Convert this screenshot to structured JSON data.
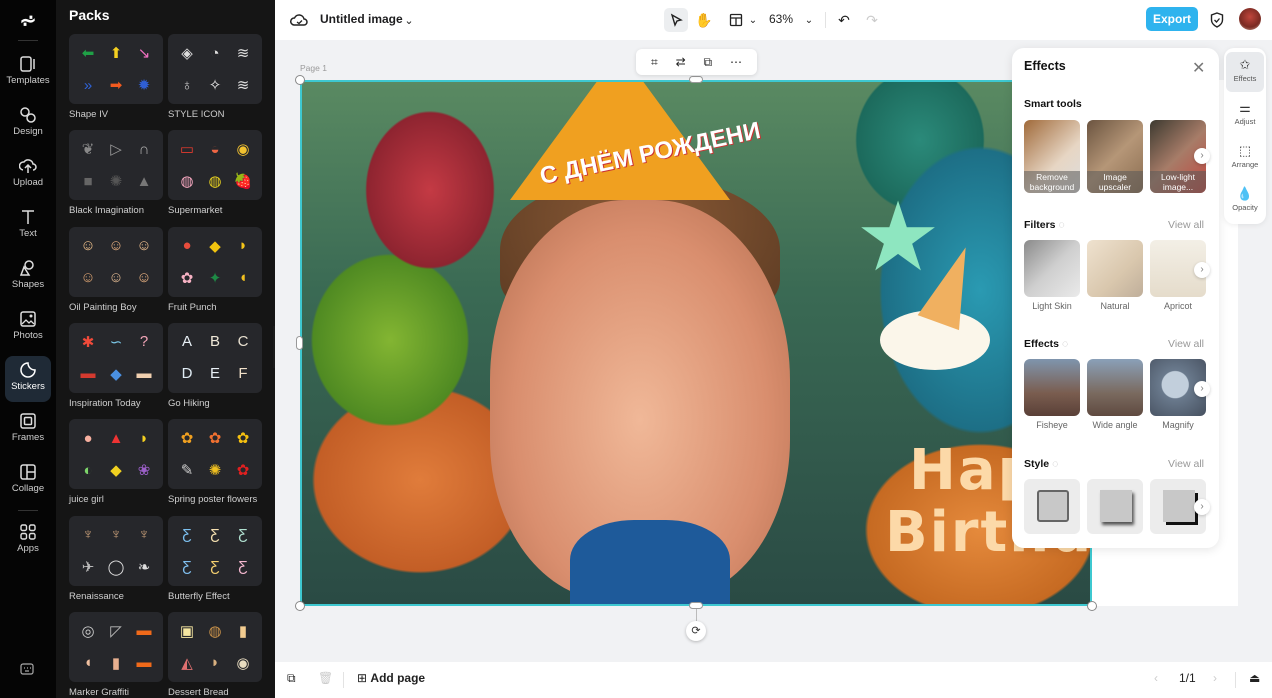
{
  "rail": {
    "items": [
      {
        "label": "Templates",
        "icon": "templates-icon"
      },
      {
        "label": "Design",
        "icon": "design-icon"
      },
      {
        "label": "Upload",
        "icon": "upload-icon"
      },
      {
        "label": "Text",
        "icon": "text-icon"
      },
      {
        "label": "Shapes",
        "icon": "shapes-icon"
      },
      {
        "label": "Photos",
        "icon": "photos-icon"
      },
      {
        "label": "Stickers",
        "icon": "stickers-icon",
        "active": true
      },
      {
        "label": "Frames",
        "icon": "frames-icon"
      },
      {
        "label": "Collage",
        "icon": "collage-icon"
      },
      {
        "label": "Apps",
        "icon": "apps-icon"
      }
    ]
  },
  "panel": {
    "title": "Packs",
    "packs": [
      {
        "label": "Shape IV",
        "glyphs": [
          "⬅",
          "⬆",
          "↘",
          "»",
          "➡",
          "✹"
        ]
      },
      {
        "label": "STYLE ICON",
        "glyphs": [
          "◈",
          "◔",
          "≋",
          "♁",
          "✧",
          "≋"
        ]
      },
      {
        "label": "Black Imagination",
        "glyphs": [
          "❦",
          "▷",
          "∩",
          "■",
          "✺",
          "▲"
        ]
      },
      {
        "label": "Supermarket",
        "glyphs": [
          "▭",
          "◒",
          "◉",
          "◍",
          "◍",
          "🍓"
        ]
      },
      {
        "label": "Oil Painting Boy",
        "glyphs": [
          "☺",
          "☺",
          "☺",
          "☺",
          "☺",
          "☺"
        ]
      },
      {
        "label": "Fruit Punch",
        "glyphs": [
          "●",
          "◆",
          "◗",
          "✿",
          "✦",
          "◖"
        ]
      },
      {
        "label": "Inspiration Today",
        "glyphs": [
          "✱",
          "∽",
          "?",
          "▬",
          "◆",
          "▬"
        ]
      },
      {
        "label": "Go Hiking",
        "glyphs": [
          "A",
          "B",
          "C",
          "D",
          "E",
          "F"
        ]
      },
      {
        "label": "juice girl",
        "glyphs": [
          "●",
          "▲",
          "◗",
          "◐",
          "◆",
          "❀"
        ]
      },
      {
        "label": "Spring poster flowers",
        "glyphs": [
          "✿",
          "✿",
          "✿",
          "✎",
          "✺",
          "✿"
        ]
      },
      {
        "label": "Renaissance",
        "glyphs": [
          "♆",
          "♆",
          "♆",
          "✈",
          "◯",
          "❧"
        ]
      },
      {
        "label": "Butterfly Effect",
        "glyphs": [
          "Ƹ",
          "Ƹ",
          "Ƹ",
          "Ƹ",
          "Ƹ",
          "Ƹ"
        ]
      },
      {
        "label": "Marker Graffiti",
        "glyphs": [
          "◎",
          "◸",
          "▬",
          "◖",
          "▮",
          "▬"
        ]
      },
      {
        "label": "Dessert Bread",
        "glyphs": [
          "▣",
          "◍",
          "▮",
          "◭",
          "◗",
          "◉"
        ]
      }
    ]
  },
  "topbar": {
    "doc_title": "Untitled image",
    "zoom": "63%",
    "export_label": "Export"
  },
  "canvas": {
    "page_label": "Page 1",
    "hat_text": "С ДНЁМ РОЖДЕНИ",
    "overlay_line1": "Happ",
    "overlay_line2": "Birthday"
  },
  "effects_panel": {
    "title": "Effects",
    "smart_tools": {
      "title": "Smart tools",
      "items": [
        {
          "label": "Remove background"
        },
        {
          "label": "Image upscaler"
        },
        {
          "label": "Low-light image..."
        }
      ]
    },
    "filters": {
      "title": "Filters",
      "view_all": "View all",
      "items": [
        {
          "label": "Light Skin"
        },
        {
          "label": "Natural"
        },
        {
          "label": "Apricot"
        }
      ]
    },
    "effects": {
      "title": "Effects",
      "view_all": "View all",
      "items": [
        {
          "label": "Fisheye"
        },
        {
          "label": "Wide angle"
        },
        {
          "label": "Magnify"
        }
      ]
    },
    "style": {
      "title": "Style",
      "view_all": "View all"
    }
  },
  "side_tools": [
    {
      "label": "Effects",
      "icon": "effects-icon",
      "active": true
    },
    {
      "label": "Adjust",
      "icon": "adjust-icon"
    },
    {
      "label": "Arrange",
      "icon": "arrange-icon"
    },
    {
      "label": "Opacity",
      "icon": "opacity-icon"
    }
  ],
  "bottombar": {
    "add_page": "Add page",
    "page_indicator": "1/1"
  },
  "colors": {
    "accent": "#2eb3ee",
    "selection": "#3ec8d0"
  }
}
